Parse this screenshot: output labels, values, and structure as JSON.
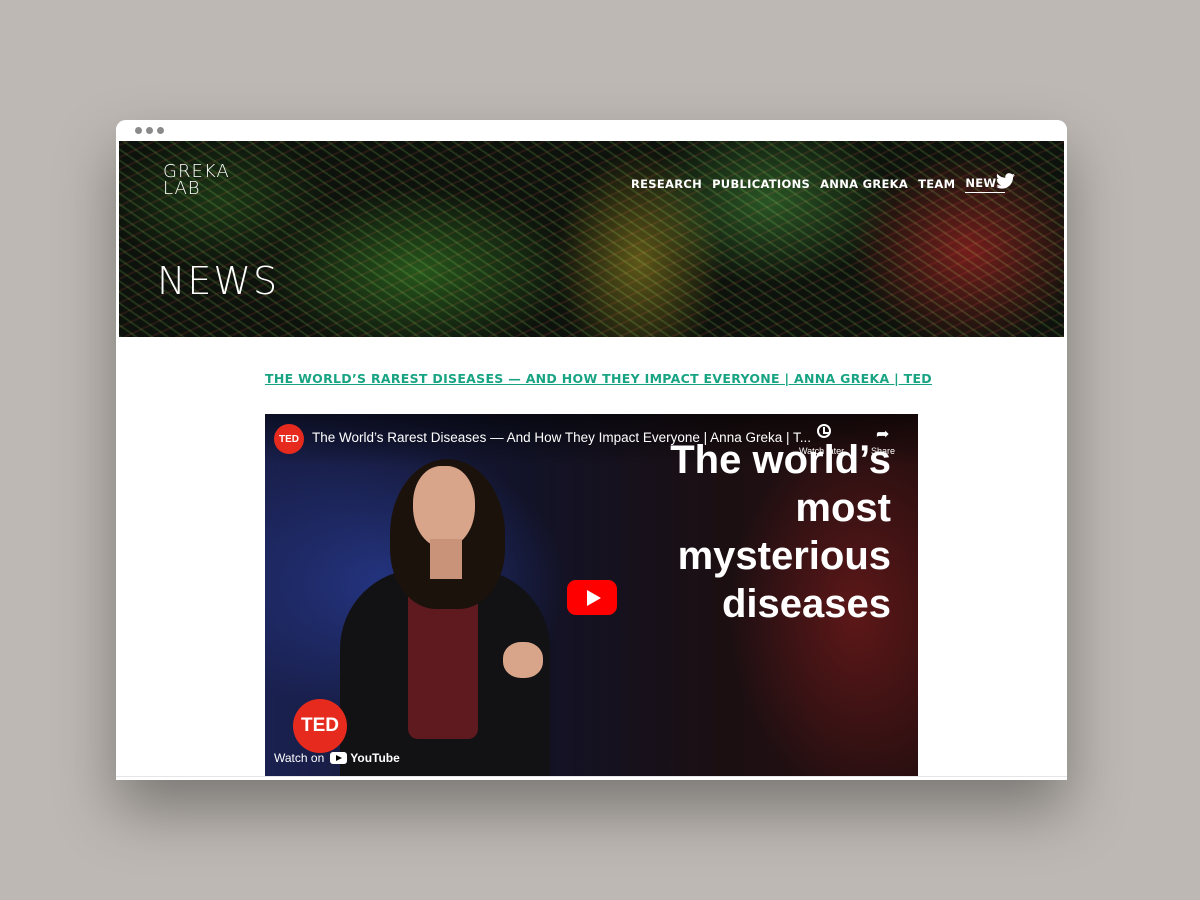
{
  "site": {
    "logo_line1": "GREKA",
    "logo_line2": "LAB"
  },
  "nav": {
    "items": [
      "RESEARCH",
      "PUBLICATIONS",
      "ANNA GREKA",
      "TEAM",
      "NEWS"
    ],
    "active": "NEWS",
    "social_icon": "twitter-icon"
  },
  "hero": {
    "title": "NEWS"
  },
  "article": {
    "link_text": "THE WORLD’S RAREST DISEASES — AND HOW THEY IMPACT EVERYONE | ANNA GREKA | TED"
  },
  "video": {
    "channel_icon_text": "TED",
    "title": "The World’s Rarest Diseases — And How They Impact Everyone | Anna Greka | T...",
    "watch_later_label": "Watch later",
    "share_label": "Share",
    "headline_lines": [
      "The world’s",
      "most",
      "mysterious",
      "diseases"
    ],
    "badge_text": "TED",
    "watch_on_label": "Watch on",
    "youtube_label": "YouTube"
  },
  "colors": {
    "link": "#18a483",
    "play_button": "#ff0000",
    "ted_red": "#e62b1e",
    "background": "#bdb8b3"
  }
}
